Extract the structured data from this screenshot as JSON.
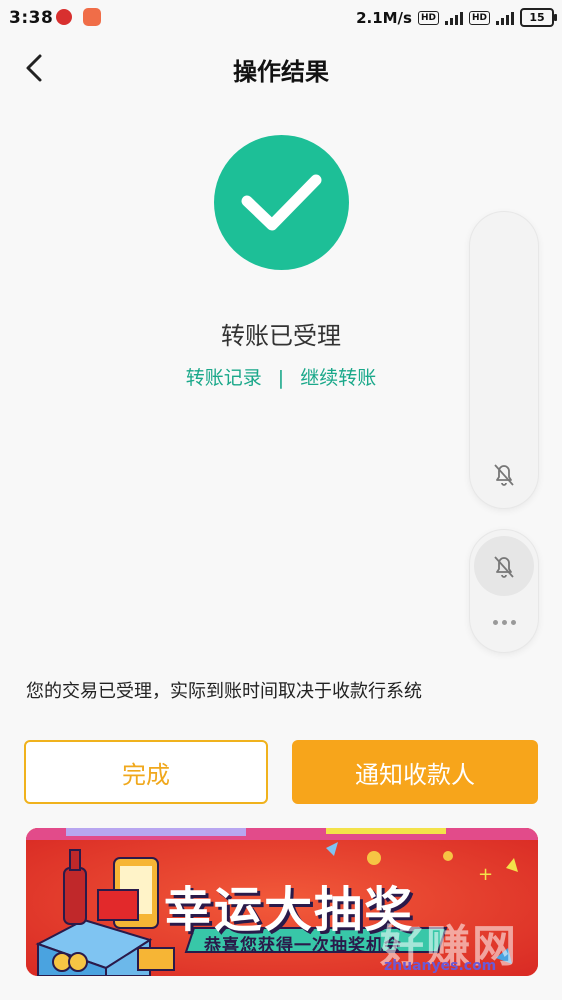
{
  "status_bar": {
    "time": "3:38",
    "speed": "2.1M/s",
    "battery": "15"
  },
  "nav": {
    "title": "操作结果"
  },
  "result": {
    "message": "转账已受理",
    "link_records": "转账记录",
    "separator": "|",
    "link_continue": "继续转账"
  },
  "notice": "您的交易已受理，实际到账时间取决于收款行系统",
  "buttons": {
    "done": "完成",
    "notify": "通知收款人"
  },
  "banner": {
    "title": "幸运大抽奖",
    "subtitle": "恭喜您获得一次抽奖机会"
  },
  "watermark": {
    "main": "好赚网",
    "url": "zhuanyes.com"
  },
  "colors": {
    "accent_green": "#1dbf97",
    "link_green": "#1aa88a",
    "orange": "#f7a51b",
    "banner_red": "#e8392b"
  }
}
